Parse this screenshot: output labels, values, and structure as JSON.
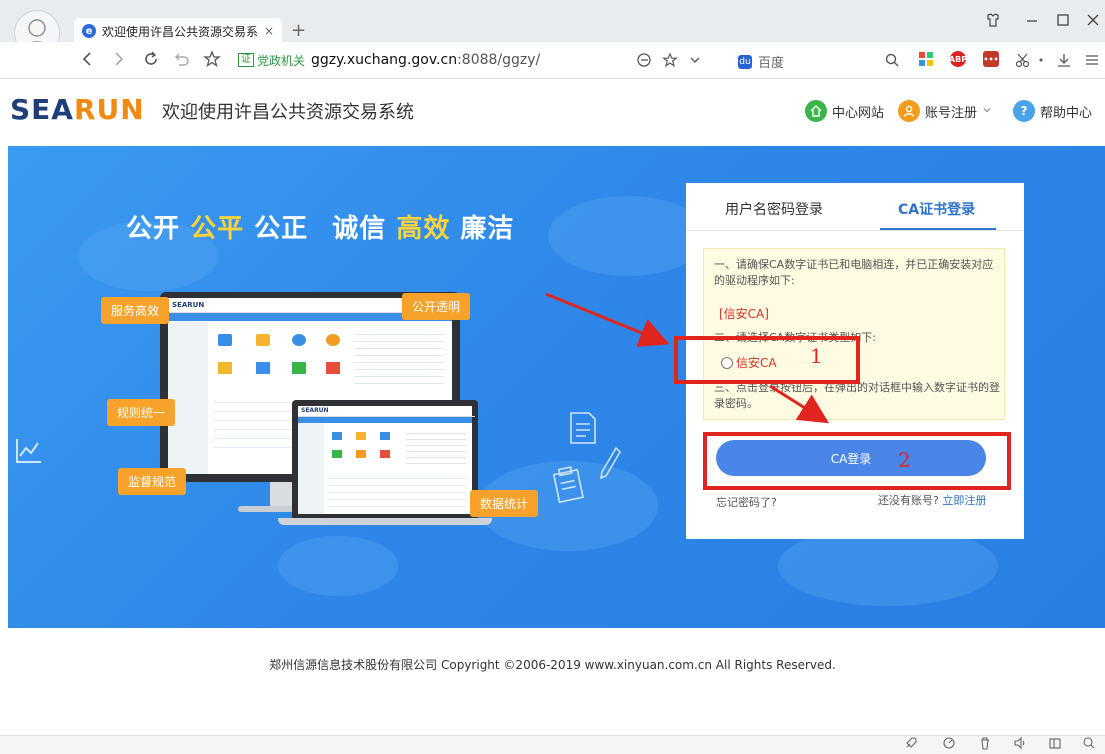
{
  "browser": {
    "tab_title": "欢迎使用许昌公共资源交易系统",
    "tab_close": "×",
    "new_tab": "+",
    "address": {
      "badge": "证",
      "category": "党政机关",
      "host": "ggzy.xuchang.gov.cn",
      "rest": ":8088/ggzy/"
    },
    "search_engine": "百度",
    "ext_abp": "ABP",
    "icons": {
      "back": "chevron-left-icon",
      "forward": "chevron-right-icon",
      "reload": "reload-icon",
      "undo": "undo-icon",
      "favorite": "star-icon",
      "reader": "reader-icon",
      "search": "search-icon",
      "download": "download-icon",
      "menu": "menu-icon"
    }
  },
  "header": {
    "logo_part1": "SEA",
    "logo_part2": "RUN",
    "title": "欢迎使用许昌公共资源交易系统",
    "links": [
      {
        "label": "中心网站",
        "icon": "home-icon",
        "color": "#3bb449"
      },
      {
        "label": "账号注册",
        "icon": "user-icon",
        "color": "#f39c1b",
        "dropdown": true
      },
      {
        "label": "帮助中心",
        "icon": "question-icon",
        "color": "#4aa3e8"
      }
    ]
  },
  "banner": {
    "slogan": {
      "p1": "公开",
      "p2": "公平",
      "p3": "公正",
      "p4": "诚信",
      "p5": "高效",
      "p6": "廉洁"
    },
    "badges": [
      "服务高效",
      "公开透明",
      "规则统一",
      "监督规范",
      "数据统计"
    ],
    "mini_logo": "SEARUN"
  },
  "login": {
    "tabs": [
      "用户名密码登录",
      "CA证书登录"
    ],
    "active_tab": 1,
    "step1": "一、请确保CA数字证书已和电脑相连，并已正确安装对应的驱动程序如下:",
    "driver": "[信安CA]",
    "step2": "二、请选择CA数字证书类型如下:",
    "radio_label": "信安CA",
    "step3": "三、点击登录按钮后，在弹出的对话框中输入数字证书的登录密码。",
    "button": "CA登录",
    "forgot": "忘记密码了?",
    "no_account": "还没有账号?",
    "register": "立即注册"
  },
  "annotations": [
    "1",
    "2"
  ],
  "footer": {
    "copyright": "郑州信源信息技术股份有限公司 Copyright ©2006-2019 www.xinyuan.com.cn All Rights Reserved."
  },
  "colors": {
    "banner": "#2e86e8",
    "badge": "#f6a22b",
    "accent": "#2f72c9",
    "annotation": "#e0251e"
  }
}
